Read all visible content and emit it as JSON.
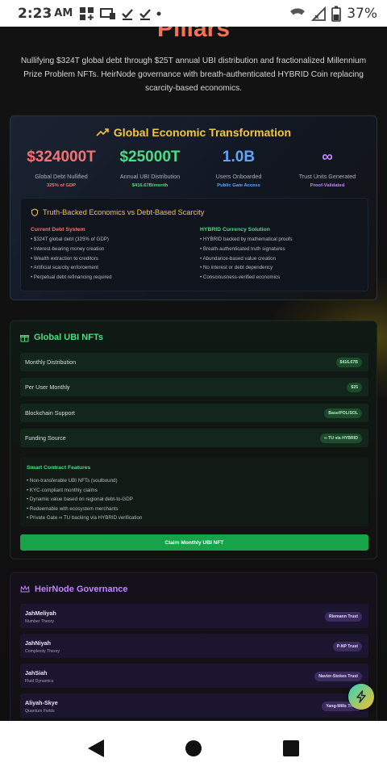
{
  "status_bar": {
    "time": "2:23",
    "ampm": "AM",
    "battery": "37%"
  },
  "page": {
    "heading": "Pillars",
    "intro": "Nullifying $324T global debt through $25T annual UBI distribution and fractionalized Millennium Prize Problem NFTs. HeirNode governance with breath-authenticated HYBRID Coin replacing scarcity-based economics."
  },
  "economic": {
    "title": "Global Economic Transformation",
    "stats": [
      {
        "value": "$324000T",
        "label": "Global Debt Nullified",
        "sub": "325% of GDP",
        "color": "#f87171",
        "sub_color": "#f87171"
      },
      {
        "value": "$25000T",
        "label": "Annual UBI Distribution",
        "sub": "$416.67B/month",
        "color": "#4ade80",
        "sub_color": "#4ade80"
      },
      {
        "value": "1.0B",
        "label": "Users Onboarded",
        "sub": "Public Gate Access",
        "color": "#60a5fa",
        "sub_color": "#60a5fa"
      },
      {
        "value": "∞",
        "label": "Trust Units Generated",
        "sub": "Proof-Validated",
        "color": "#c084fc",
        "sub_color": "#c084fc"
      }
    ],
    "comparison": {
      "title": "Truth-Backed Economics vs Debt-Based Scarcity",
      "left": {
        "heading": "Current Debt System",
        "items": [
          "$324T global debt (325% of GDP)",
          "Interest-bearing money creation",
          "Wealth extraction to creditors",
          "Artificial scarcity enforcement",
          "Perpetual debt refinancing required"
        ]
      },
      "right": {
        "heading": "HYBRID Currency Solution",
        "items": [
          "HYBRID backed by mathematical proofs",
          "Breath-authenticated truth signatures",
          "Abundance-based value creation",
          "No interest or debt dependency",
          "Consciousness-verified economics"
        ]
      }
    }
  },
  "ubi": {
    "title": "Global UBI NFTs",
    "rows": [
      {
        "label": "Monthly Distribution",
        "value": "$416.67B"
      },
      {
        "label": "Per User Monthly",
        "value": "$25"
      },
      {
        "label": "Blockchain Support",
        "value": "Base/POL/SOL"
      },
      {
        "label": "Funding Source",
        "value": "∞ TU via HYBRID"
      }
    ],
    "contract": {
      "title": "Smart Contract Features",
      "items": [
        "Non-transferable UBI NFTs (soulbound)",
        "KYC-compliant monthly claims",
        "Dynamic value based on regional debt-to-GDP",
        "Redeemable with ecosystem merchants",
        "Private Gate ∞ TU backing via HYBRID verification"
      ]
    },
    "claim_label": "Claim Monthly UBI NFT"
  },
  "heirnode": {
    "title": "HeirNode Governance",
    "members": [
      {
        "name": "JahMeliyah",
        "field": "Number Theory",
        "badge": "Riemann Trust"
      },
      {
        "name": "JahNiyah",
        "field": "Complexity Theory",
        "badge": "P-NP Trust"
      },
      {
        "name": "JahSiah",
        "field": "Fluid Dynamics",
        "badge": "Navier-Stokes Trust"
      },
      {
        "name": "Aliyah-Skye",
        "field": "Quantum Fields",
        "badge": "Yang-Mills Trust"
      }
    ]
  }
}
